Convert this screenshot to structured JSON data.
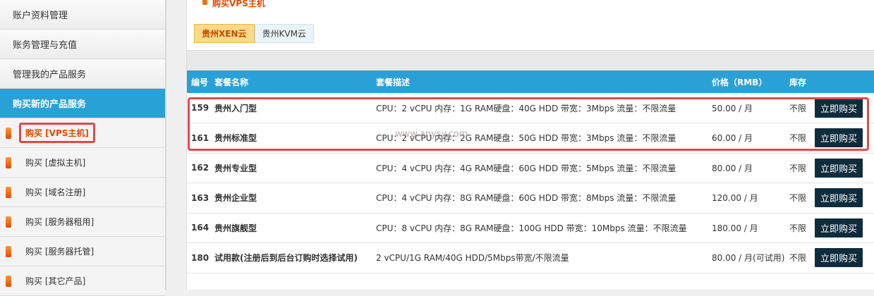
{
  "sidebar": {
    "items": [
      {
        "label": "账户资料管理"
      },
      {
        "label": "账务管理与充值"
      },
      {
        "label": "管理我的产品服务"
      },
      {
        "label": "购买新的产品服务"
      }
    ],
    "sub_items": [
      {
        "label": "购买 [VPS主机]"
      },
      {
        "label": "购买 [虚拟主机]"
      },
      {
        "label": "购买 [域名注册]"
      },
      {
        "label": "购买 [服务器租用]"
      },
      {
        "label": "购买 [服务器托管]"
      },
      {
        "label": "购买 [其它产品]"
      }
    ]
  },
  "main": {
    "section_title": "购买VPS主机",
    "tabs": [
      {
        "label": "贵州XEN云"
      },
      {
        "label": "贵州KVM云"
      }
    ],
    "table": {
      "headers": [
        "编号",
        "套餐名称",
        "套餐描述",
        "价格（RMB）",
        "库存",
        ""
      ],
      "rows": [
        {
          "id": "159",
          "name": "贵州入门型",
          "desc": "CPU：2 vCPU 内存：1G RAM硬盘：40G HDD 带宽：3Mbps 流量：不限流量",
          "price": "50.00 / 月",
          "stock": "不限",
          "button": "立即购买"
        },
        {
          "id": "161",
          "name": "贵州标准型",
          "desc": "CPU：2 vCPU 内存：2G RAM硬盘：50G HDD 带宽：3Mbps 流量：不限流量",
          "price": "60.00 / 月",
          "stock": "不限",
          "button": "立即购买"
        },
        {
          "id": "162",
          "name": "贵州专业型",
          "desc": "CPU：4 vCPU 内存：4G RAM硬盘：60G HDD 带宽：5Mbps 流量：不限流量",
          "price": "80.00 / 月",
          "stock": "不限",
          "button": "立即购买"
        },
        {
          "id": "163",
          "name": "贵州企业型",
          "desc": "CPU：4 vCPU 内存：8G RAM硬盘：60G HDD 带宽：8Mbps 流量：不限流量",
          "price": "120.00 / 月",
          "stock": "不限",
          "button": "立即购买"
        },
        {
          "id": "164",
          "name": "贵州旗舰型",
          "desc": "CPU：8 vCPU 内存：8G RAM硬盘：100G HDD 带宽：10Mbps 流量：不限流量",
          "price": "180.00 / 月",
          "stock": "不限",
          "button": "立即购买"
        },
        {
          "id": "180",
          "name": "试用款(注册后到后台订购时选择试用)",
          "desc": "2 vCPU/1G RAM/40G HDD/5Mbps带宽/不限流量",
          "price": "80.00 / 月(可试用)",
          "stock": "不限",
          "button": "立即购买"
        }
      ]
    }
  },
  "watermark": "www.anysy.com",
  "colors": {
    "accent": "#2aa1d6",
    "highlight": "#e04a4a",
    "button": "#0f2c3d"
  }
}
